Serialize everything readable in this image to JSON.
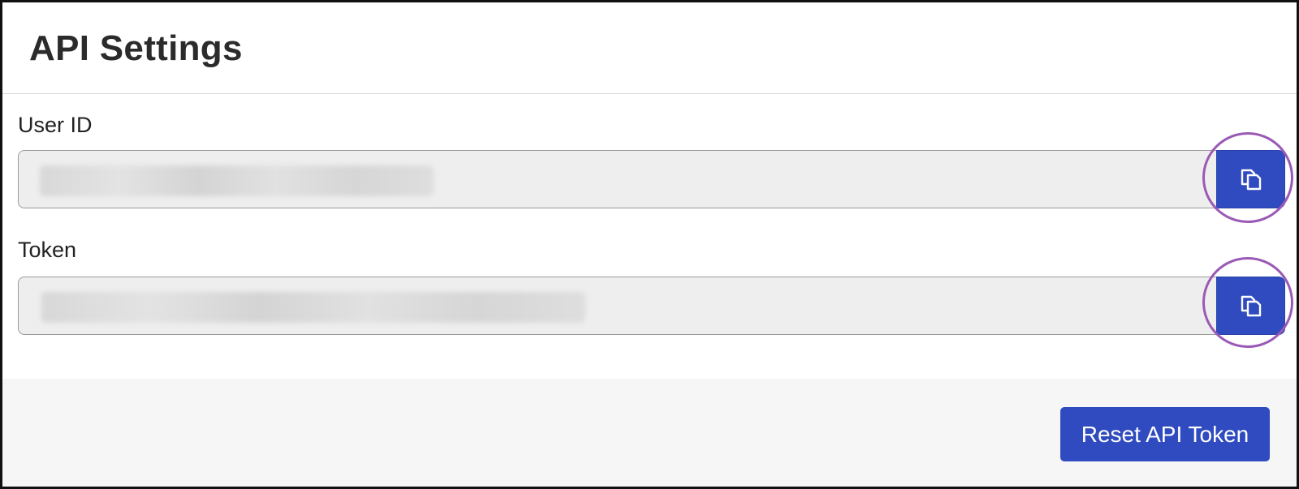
{
  "page": {
    "title": "API Settings"
  },
  "fields": {
    "user_id": {
      "label": "User ID",
      "copy_icon": "copy-icon"
    },
    "token": {
      "label": "Token",
      "copy_icon": "copy-icon"
    }
  },
  "footer": {
    "reset_label": "Reset API Token"
  },
  "colors": {
    "primary": "#2f4bbf",
    "highlight": "#9b59b6",
    "input_background": "#eeeeee",
    "footer_background": "#f6f6f6"
  }
}
